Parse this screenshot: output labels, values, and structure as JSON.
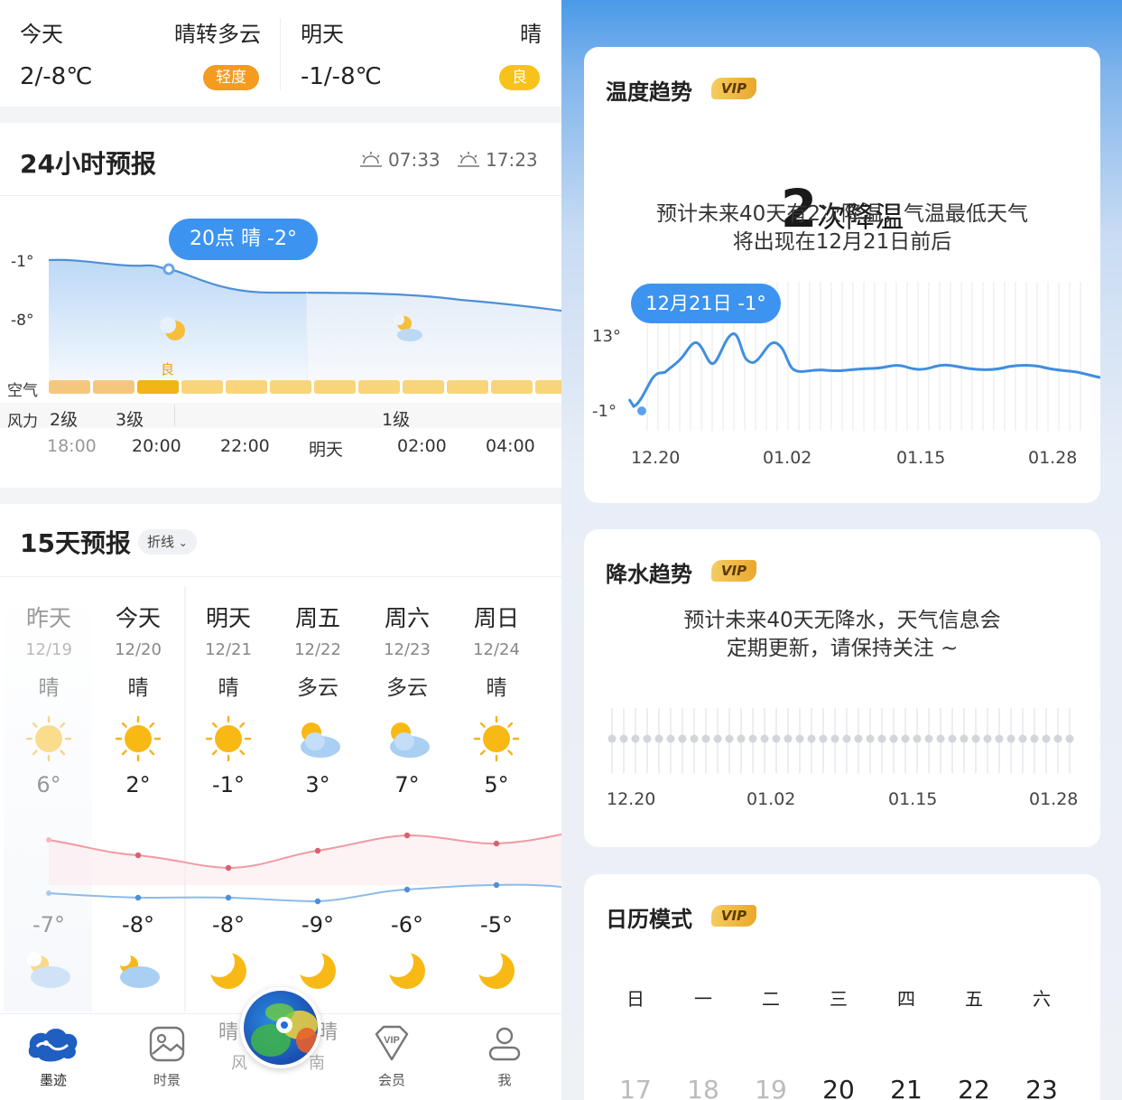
{
  "top": {
    "today": {
      "day": "今天",
      "weather": "晴转多云",
      "temp": "2/-8℃",
      "aqi": "轻度",
      "aqi_color": "#f49b20"
    },
    "tomorrow": {
      "day": "明天",
      "weather": "晴",
      "temp": "-1/-8℃",
      "aqi": "良",
      "aqi_color": "#f7c31b"
    }
  },
  "hourly": {
    "title": "24小时预报",
    "sunrise": "07:33",
    "sunset": "17:23",
    "bubble": "20点 晴 -2°",
    "y_labels": [
      "-1°",
      "-8°"
    ],
    "air_label": "空气",
    "air_good": "良",
    "wind_label": "风力",
    "wind": [
      "2级",
      "3级",
      "1级"
    ],
    "times": [
      "18:00",
      "20:00",
      "22:00",
      "明天",
      "02:00",
      "04:00"
    ],
    "colors": {
      "line": "#4e8fd6",
      "air": "#f6c34a",
      "air_active": "#f1b515"
    }
  },
  "daily": {
    "title": "15天预报",
    "mode": "折线",
    "days": [
      {
        "name": "昨天",
        "date": "12/19",
        "weather": "晴",
        "hi": "6°",
        "lo": "-7°",
        "icon_day": "sun-icon",
        "icon_night": "cloud-moon-icon"
      },
      {
        "name": "今天",
        "date": "12/20",
        "weather": "晴",
        "hi": "2°",
        "lo": "-8°",
        "icon_day": "sun-icon",
        "icon_night": "cloud-moon-icon"
      },
      {
        "name": "明天",
        "date": "12/21",
        "weather": "晴",
        "hi": "-1°",
        "lo": "-8°",
        "icon_day": "sun-icon",
        "icon_night": "moon-icon"
      },
      {
        "name": "周五",
        "date": "12/22",
        "weather": "多云",
        "hi": "3°",
        "lo": "-9°",
        "icon_day": "sun-cloud-icon",
        "icon_night": "moon-icon"
      },
      {
        "name": "周六",
        "date": "12/23",
        "weather": "多云",
        "hi": "7°",
        "lo": "-6°",
        "icon_day": "sun-cloud-icon",
        "icon_night": "moon-icon"
      },
      {
        "name": "周日",
        "date": "12/24",
        "weather": "晴",
        "hi": "5°",
        "lo": "-5°",
        "icon_day": "sun-icon",
        "icon_night": "moon-icon"
      }
    ]
  },
  "nav": {
    "items": [
      "墨迹",
      "时景",
      "会员",
      "我"
    ],
    "behind": [
      "晴",
      "风",
      "晴",
      "南"
    ]
  },
  "trend": {
    "title": "温度趋势",
    "vip": "VIP",
    "count": "2",
    "count_text": "次降温",
    "desc1": "预计未来40天有2次降温，气温最低天气",
    "desc2": "将出现在12月21日前后",
    "bubble": "12月21日 -1°",
    "y_labels": [
      "13°",
      "-1°"
    ],
    "x_labels": [
      "12.20",
      "01.02",
      "01.15",
      "01.28"
    ]
  },
  "rain": {
    "title": "降水趋势",
    "vip": "VIP",
    "desc1": "预计未来40天无降水，天气信息会",
    "desc2": "定期更新，请保持关注 ~",
    "x_labels": [
      "12.20",
      "01.02",
      "01.15",
      "01.28"
    ]
  },
  "calendar": {
    "title": "日历模式",
    "vip": "VIP",
    "weekdays": [
      "日",
      "一",
      "二",
      "三",
      "四",
      "五",
      "六"
    ],
    "dates": [
      "17",
      "18",
      "19",
      "20",
      "21",
      "22",
      "23"
    ]
  }
}
